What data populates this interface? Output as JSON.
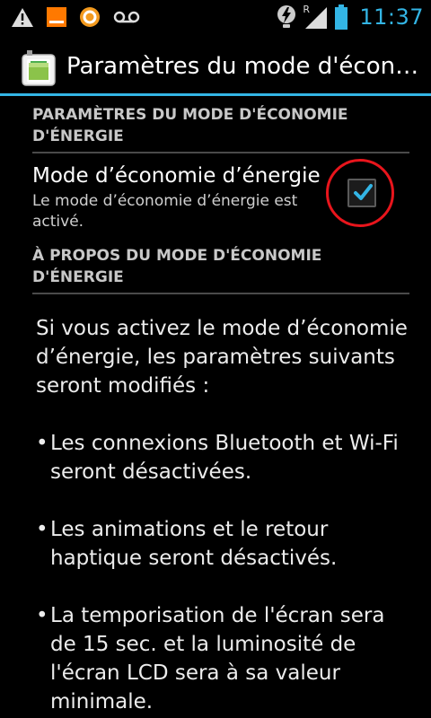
{
  "status_bar": {
    "time": "11:37",
    "left_icons": [
      "warning-icon",
      "carrier-icon",
      "app-notification-icon",
      "voicemail-icon"
    ],
    "right_icons": [
      "flash-icon",
      "roaming-signal-icon",
      "battery-icon"
    ],
    "roaming_letter": "R"
  },
  "action_bar": {
    "title": "Paramètres du mode d'économie d'énergie",
    "icon": "battery-settings-icon"
  },
  "settings": {
    "category_1": "PARAMÈTRES DU MODE D'ÉCONOMIE D'ÉNERGIE",
    "power_saving": {
      "title": "Mode d’économie d’énergie",
      "summary": "Le mode d’économie d’énergie est activé.",
      "checked": true
    },
    "category_2": "À PROPOS DU MODE D'ÉCONOMIE D'ÉNERGIE"
  },
  "about": {
    "intro": "Si vous activez le mode d’économie d’énergie, les paramètres suivants seront modifiés :",
    "bullet": "•",
    "items": [
      "Les connexions Bluetooth et Wi-Fi seront désactivées.",
      "Les animations et le retour haptique seront désactivés.",
      "La temporisation de l'écran sera de 15 sec. et la luminosité de l'écran LCD sera à sa valeur minimale."
    ]
  },
  "colors": {
    "accent": "#33b5e5",
    "annotation": "#e8151c",
    "background": "#000000"
  }
}
